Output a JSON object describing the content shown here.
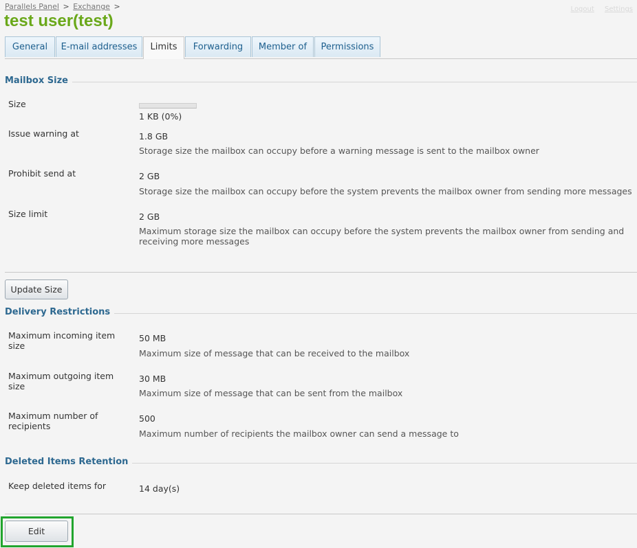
{
  "breadcrumb": {
    "items": [
      "Parallels Panel",
      "Exchange"
    ],
    "separator": ">"
  },
  "top_links": [
    "Logout",
    "Settings"
  ],
  "page": {
    "title": "test user(test)"
  },
  "tabs": [
    {
      "label": "General",
      "active": false
    },
    {
      "label": "E-mail addresses",
      "active": false
    },
    {
      "label": "Limits",
      "active": true
    },
    {
      "label": "Forwarding",
      "active": false
    },
    {
      "label": "Member of",
      "active": false
    },
    {
      "label": "Permissions",
      "active": false
    }
  ],
  "mailbox_size": {
    "title": "Mailbox Size",
    "size": {
      "label": "Size",
      "value": "1 KB (0%)",
      "usage_percent": 0
    },
    "issue_warning": {
      "label": "Issue warning at",
      "value": "1.8 GB",
      "desc": "Storage size the mailbox can occupy before a warning message is sent to the mailbox owner"
    },
    "prohibit_send": {
      "label": "Prohibit send at",
      "value": "2 GB",
      "desc": "Storage size the mailbox can occupy before the system prevents the mailbox owner from sending more messages"
    },
    "size_limit": {
      "label": "Size limit",
      "value": "2 GB",
      "desc": "Maximum storage size the mailbox can occupy before the system prevents the mailbox owner from sending and receiving more messages"
    },
    "update_button": "Update Size"
  },
  "delivery": {
    "title": "Delivery Restrictions",
    "incoming": {
      "label": "Maximum incoming item size",
      "value": "50 MB",
      "desc": "Maximum size of message that can be received to the mailbox"
    },
    "outgoing": {
      "label": "Maximum outgoing item size",
      "value": "30 MB",
      "desc": "Maximum size of message that can be sent from the mailbox"
    },
    "recipients": {
      "label": "Maximum number of recipients",
      "value": "500",
      "desc": "Maximum number of recipients the mailbox owner can send a message to"
    }
  },
  "retention": {
    "title": "Deleted Items Retention",
    "keep": {
      "label": "Keep deleted items for",
      "value": "14 day(s)"
    }
  },
  "edit_button": "Edit",
  "colors": {
    "title_green": "#6aa81a",
    "section_blue": "#2d6890",
    "tab_text": "#1d5f8e",
    "highlight_green": "#21a52d"
  }
}
